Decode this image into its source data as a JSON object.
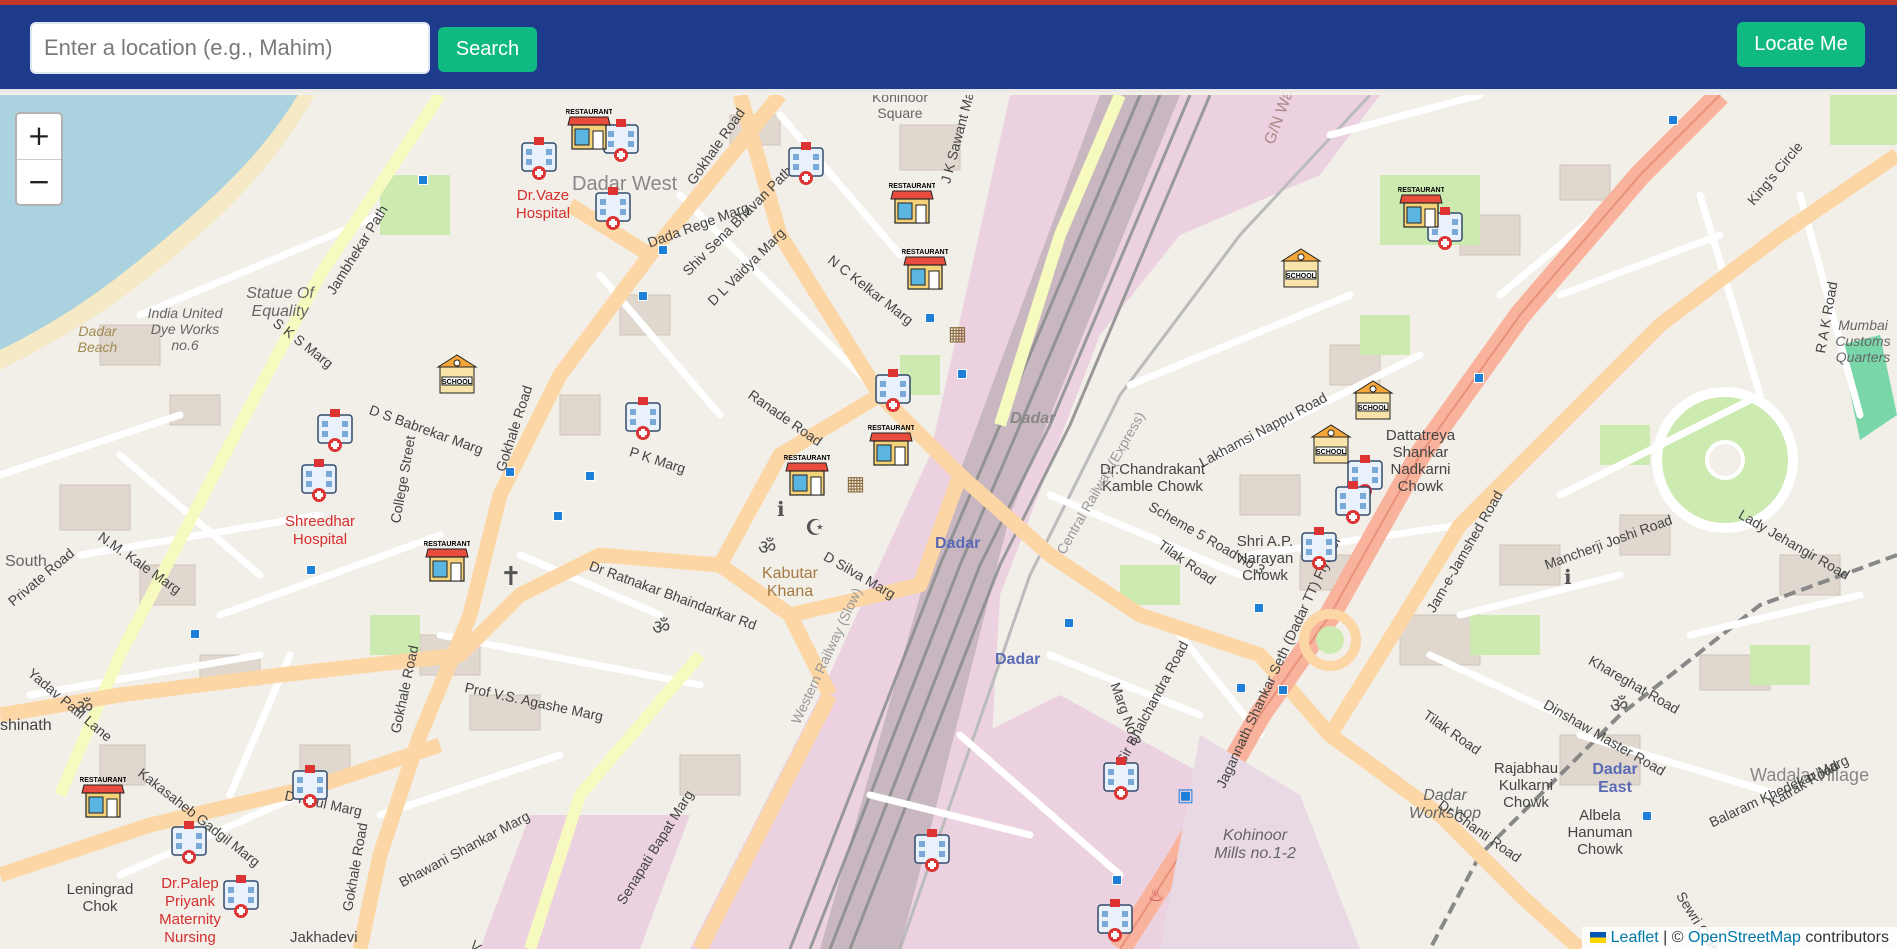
{
  "header": {
    "search_placeholder": "Enter a location (e.g., Mahim)",
    "search_label": "Search",
    "locate_label": "Locate Me"
  },
  "map": {
    "zoom_in": "+",
    "zoom_out": "−",
    "attribution": {
      "leaflet": "Leaflet",
      "separator": "| ©",
      "osm": "OpenStreetMap",
      "suffix": "contributors"
    },
    "labels": {
      "dadar_west": "Dadar West",
      "dr_vaze": "Dr.Vaze Hospital",
      "shreedhar": "Shreedhar Hospital",
      "dr_palep": "Dr.Palep Priyank Maternity Nursing",
      "statue": "Statue Of Equality",
      "india_united": "India United Dye Works no.6",
      "dadar_beach": "Dadar Beach",
      "kabutar_khana": "Kabutar Khana",
      "dadar_station1": "Dadar",
      "dadar_station2": "Dadar",
      "dadar_station3": "Dadar",
      "dadar_east": "Dadar East",
      "dr_kamble": "Dr.Chandrakant Kamble Chowk",
      "shri_narayan": "Shri A.P. Narayan Chowk",
      "dattatreya": "Dattatreya Shankar Nadkarni Chowk",
      "rajabhau": "Rajabhau Kulkarni Chowk",
      "albela": "Albela Hanuman Chowk",
      "dadar_workshop": "Dadar Workshop",
      "kohinoor": "Kohinoor Mills no.1-2",
      "wadala": "Wadala Village",
      "mumbai_customs": "Mumbai Customs Quarters",
      "leningrad": "Leningrad Chok",
      "south": "South",
      "shinath": "shinath",
      "kohinoor_square": "Kohinoor Square",
      "gn_ward": "G/N Ward",
      "jakhadevi": "Jakhadevi"
    },
    "roads": {
      "gokhale1": "Gokhale Road",
      "gokhale2": "Gokhale Road",
      "gokhale3": "Gokhale Road",
      "gokhale4": "Gokhale Road",
      "tilak1": "Tilak Road",
      "tilak2": "Tilak Road",
      "senapati": "Senapati Bapat Marg",
      "bhawani": "Bhawani Shankar Marg",
      "ranade": "Ranade Road",
      "nc_kelkar": "N C Kelkar Marg",
      "dada_rege": "Dada Rege Marg",
      "ds_babrekar": "D S Babrekar Marg",
      "pk_marg": "P K Marg",
      "dr_ratnakar": "Dr Ratnakar Bhaindarkar Rd",
      "agashe": "Prof V.S. Agashe Marg",
      "d_raul": "D Raul Marg",
      "nm_kale": "N.M. Kale Marg",
      "private_road": "Private Road",
      "yadav_patil": "Yadav Patil Lane",
      "college": "College Street",
      "jambhekar": "Jambhekar Path",
      "sks": "S K S Marg",
      "jagannath": "Jagannath Shankar Seth (Dadar TT) Flyover",
      "kings_circle": "King's Circle",
      "lakhamsi": "Lakhamsi Nappu Road",
      "scheme5": "Scheme 5 Road no 3",
      "bhalchandra": "Sir Bhalchandra Road",
      "marg2": "Marg No 2",
      "mancherji": "Mancherji Joshi Road",
      "jame": "Jam-e-Jamshed Road",
      "lady_jehangir": "Lady Jehangir Road",
      "dinshaw": "Dinshaw Master Road",
      "khareghat": "Khareghat Road",
      "dr_ghanti": "Dr Ghanti Road",
      "katrak": "Katrak Road",
      "balaram": "Balaram Khedekar Marg",
      "sewri": "Sewri Cross Road",
      "western_rly": "Western Railway (Slow)",
      "central_rly": "Central Railway (Express)",
      "ds_silva": "D Silva Marg",
      "shiv_sena": "Shiv Sena Bhavan Path",
      "dl_vaidya": "D L Vaidya Marg",
      "jk_sawant": "J K Sawant Marg",
      "kakasaheb": "Kakasaheb Gadgil Marg",
      "vs_marg": "V. S. Marg",
      "rak_road": "R A K Road"
    },
    "markers": [
      {
        "type": "hospital",
        "icon": "hospital-icon"
      },
      {
        "type": "restaurant",
        "icon": "restaurant-icon",
        "text": "RESTAURANT"
      },
      {
        "type": "school",
        "icon": "school-icon",
        "text": "SCHOOL"
      }
    ]
  },
  "colors": {
    "header_bg": "#1e3a8a",
    "button_green": "#10b981",
    "water": "#aad3df",
    "primary_road": "#fcd6a4",
    "trunk_road": "#f9b29c",
    "railway_area": "#e5ccd9",
    "park": "#c8facc"
  }
}
